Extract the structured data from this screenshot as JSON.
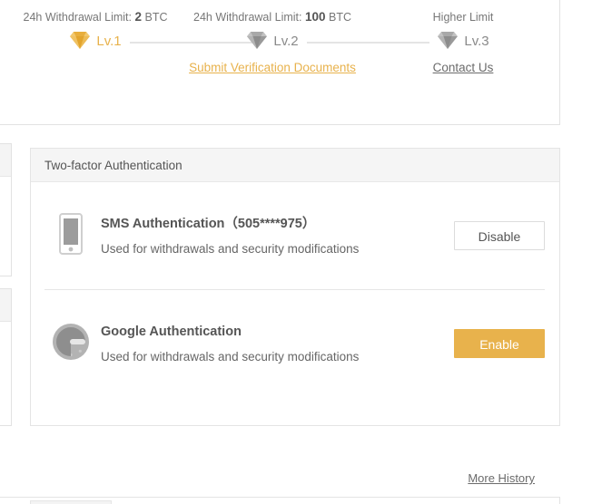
{
  "limits_panel": {
    "levels": [
      {
        "caption_label": "24h Withdrawal Limit:",
        "caption_amount": "2",
        "caption_unit": "BTC",
        "level_name": "Lv.1",
        "icon": "diamond-icon",
        "state": "active",
        "link": null
      },
      {
        "caption_label": "24h Withdrawal Limit:",
        "caption_amount": "100",
        "caption_unit": "BTC",
        "level_name": "Lv.2",
        "icon": "diamond-icon",
        "state": "inactive",
        "link": "Submit Verification Documents"
      },
      {
        "caption_label": "Higher Limit",
        "caption_amount": "",
        "caption_unit": "",
        "level_name": "Lv.3",
        "icon": "diamond-icon",
        "state": "inactive",
        "link": "Contact Us"
      }
    ]
  },
  "twofa": {
    "header_title": "Two-factor Authentication",
    "rows": [
      {
        "icon": "mobile-phone-icon",
        "title": "SMS Authentication（505****975）",
        "description": "Used for withdrawals and security modifications",
        "button_label": "Disable",
        "button_style": "outline"
      },
      {
        "icon": "google-authenticator-icon",
        "title": "Google Authentication",
        "description": "Used for withdrawals and security modifications",
        "button_label": "Enable",
        "button_style": "primary"
      }
    ]
  },
  "footer": {
    "more_history_label": "More History"
  },
  "colors": {
    "accent_gold": "#E8B24C",
    "text_grey": "#666666",
    "border_grey": "#E4E4E4",
    "header_bg": "#F5F5F5"
  }
}
